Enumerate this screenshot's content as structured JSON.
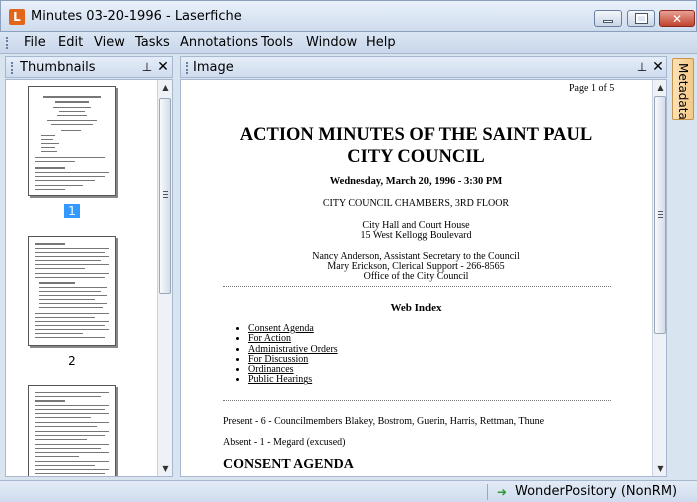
{
  "window": {
    "app_icon_letter": "L",
    "title": "Minutes 03-20-1996 - Laserfiche",
    "minimize_icon": "minimize-icon",
    "maximize_icon": "maximize-icon",
    "close_glyph": "✕"
  },
  "menu": [
    "File",
    "Edit",
    "View",
    "Tasks",
    "Annotations",
    "Tools",
    "Window",
    "Help"
  ],
  "thumbnails_pane": {
    "title": "Thumbnails",
    "pin_glyph": "⊥",
    "close_glyph": "✕",
    "labels": [
      "1",
      "2"
    ]
  },
  "image_pane": {
    "title": "Image",
    "pin_glyph": "⊥",
    "close_glyph": "✕"
  },
  "document": {
    "page_indicator": "Page 1 of 5",
    "title_line1": "ACTION MINUTES OF THE SAINT PAUL",
    "title_line2": "CITY COUNCIL",
    "date": "Wednesday, March 20, 1996 - 3:30 PM",
    "location": "CITY COUNCIL CHAMBERS, 3RD FLOOR",
    "address_line1": "City Hall and Court House",
    "address_line2": "15 West Kellogg Boulevard",
    "staff_line1": "Nancy Anderson, Assistant Secretary to the Council",
    "staff_line2": "Mary Erickson, Clerical Support - 266-8565",
    "staff_line3": "Office of the City Council",
    "web_index_heading": "Web Index",
    "links": [
      "Consent Agenda",
      "For Action",
      "Administrative Orders",
      "For Discussion",
      "Ordinances",
      "Public Hearings"
    ],
    "present": "Present - 6 - Councilmembers Blakey, Bostrom, Guerin, Harris, Rettman, Thune",
    "absent": "Absent - 1 - Megard (excused)",
    "section_heading": "CONSENT AGENDA"
  },
  "side_tab": {
    "label": "Metadata"
  },
  "status": {
    "repository": "WonderPository (NonRM)",
    "repo_icon": "repository-arrow-icon"
  },
  "colors": {
    "selection": "#3399ff",
    "app_icon": "#e2651a",
    "metadata_tab": "#f5c985"
  }
}
